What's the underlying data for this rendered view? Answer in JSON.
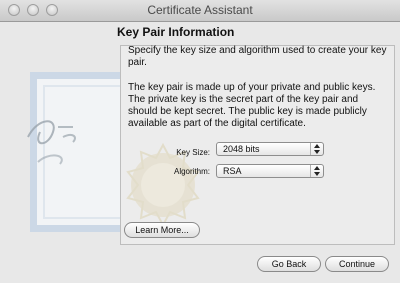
{
  "window": {
    "title": "Certificate Assistant"
  },
  "section": {
    "heading": "Key Pair Information"
  },
  "text": {
    "intro": "Specify the key size and algorithm used to create your key pair.",
    "explanation": "The key pair is made up of your private and public keys. The private key is the secret part of the key pair and should be kept secret. The public key is made publicly available as part of the digital certificate."
  },
  "form": {
    "key_size_label": "Key Size:",
    "key_size_value": "2048 bits",
    "algorithm_label": "Algorithm:",
    "algorithm_value": "RSA"
  },
  "buttons": {
    "learn_more": "Learn More...",
    "go_back": "Go Back",
    "continue": "Continue"
  },
  "colors": {
    "window_bg": "#e8e8e8",
    "content_bg": "#ececec",
    "cert_border": "#c9d7e6"
  }
}
